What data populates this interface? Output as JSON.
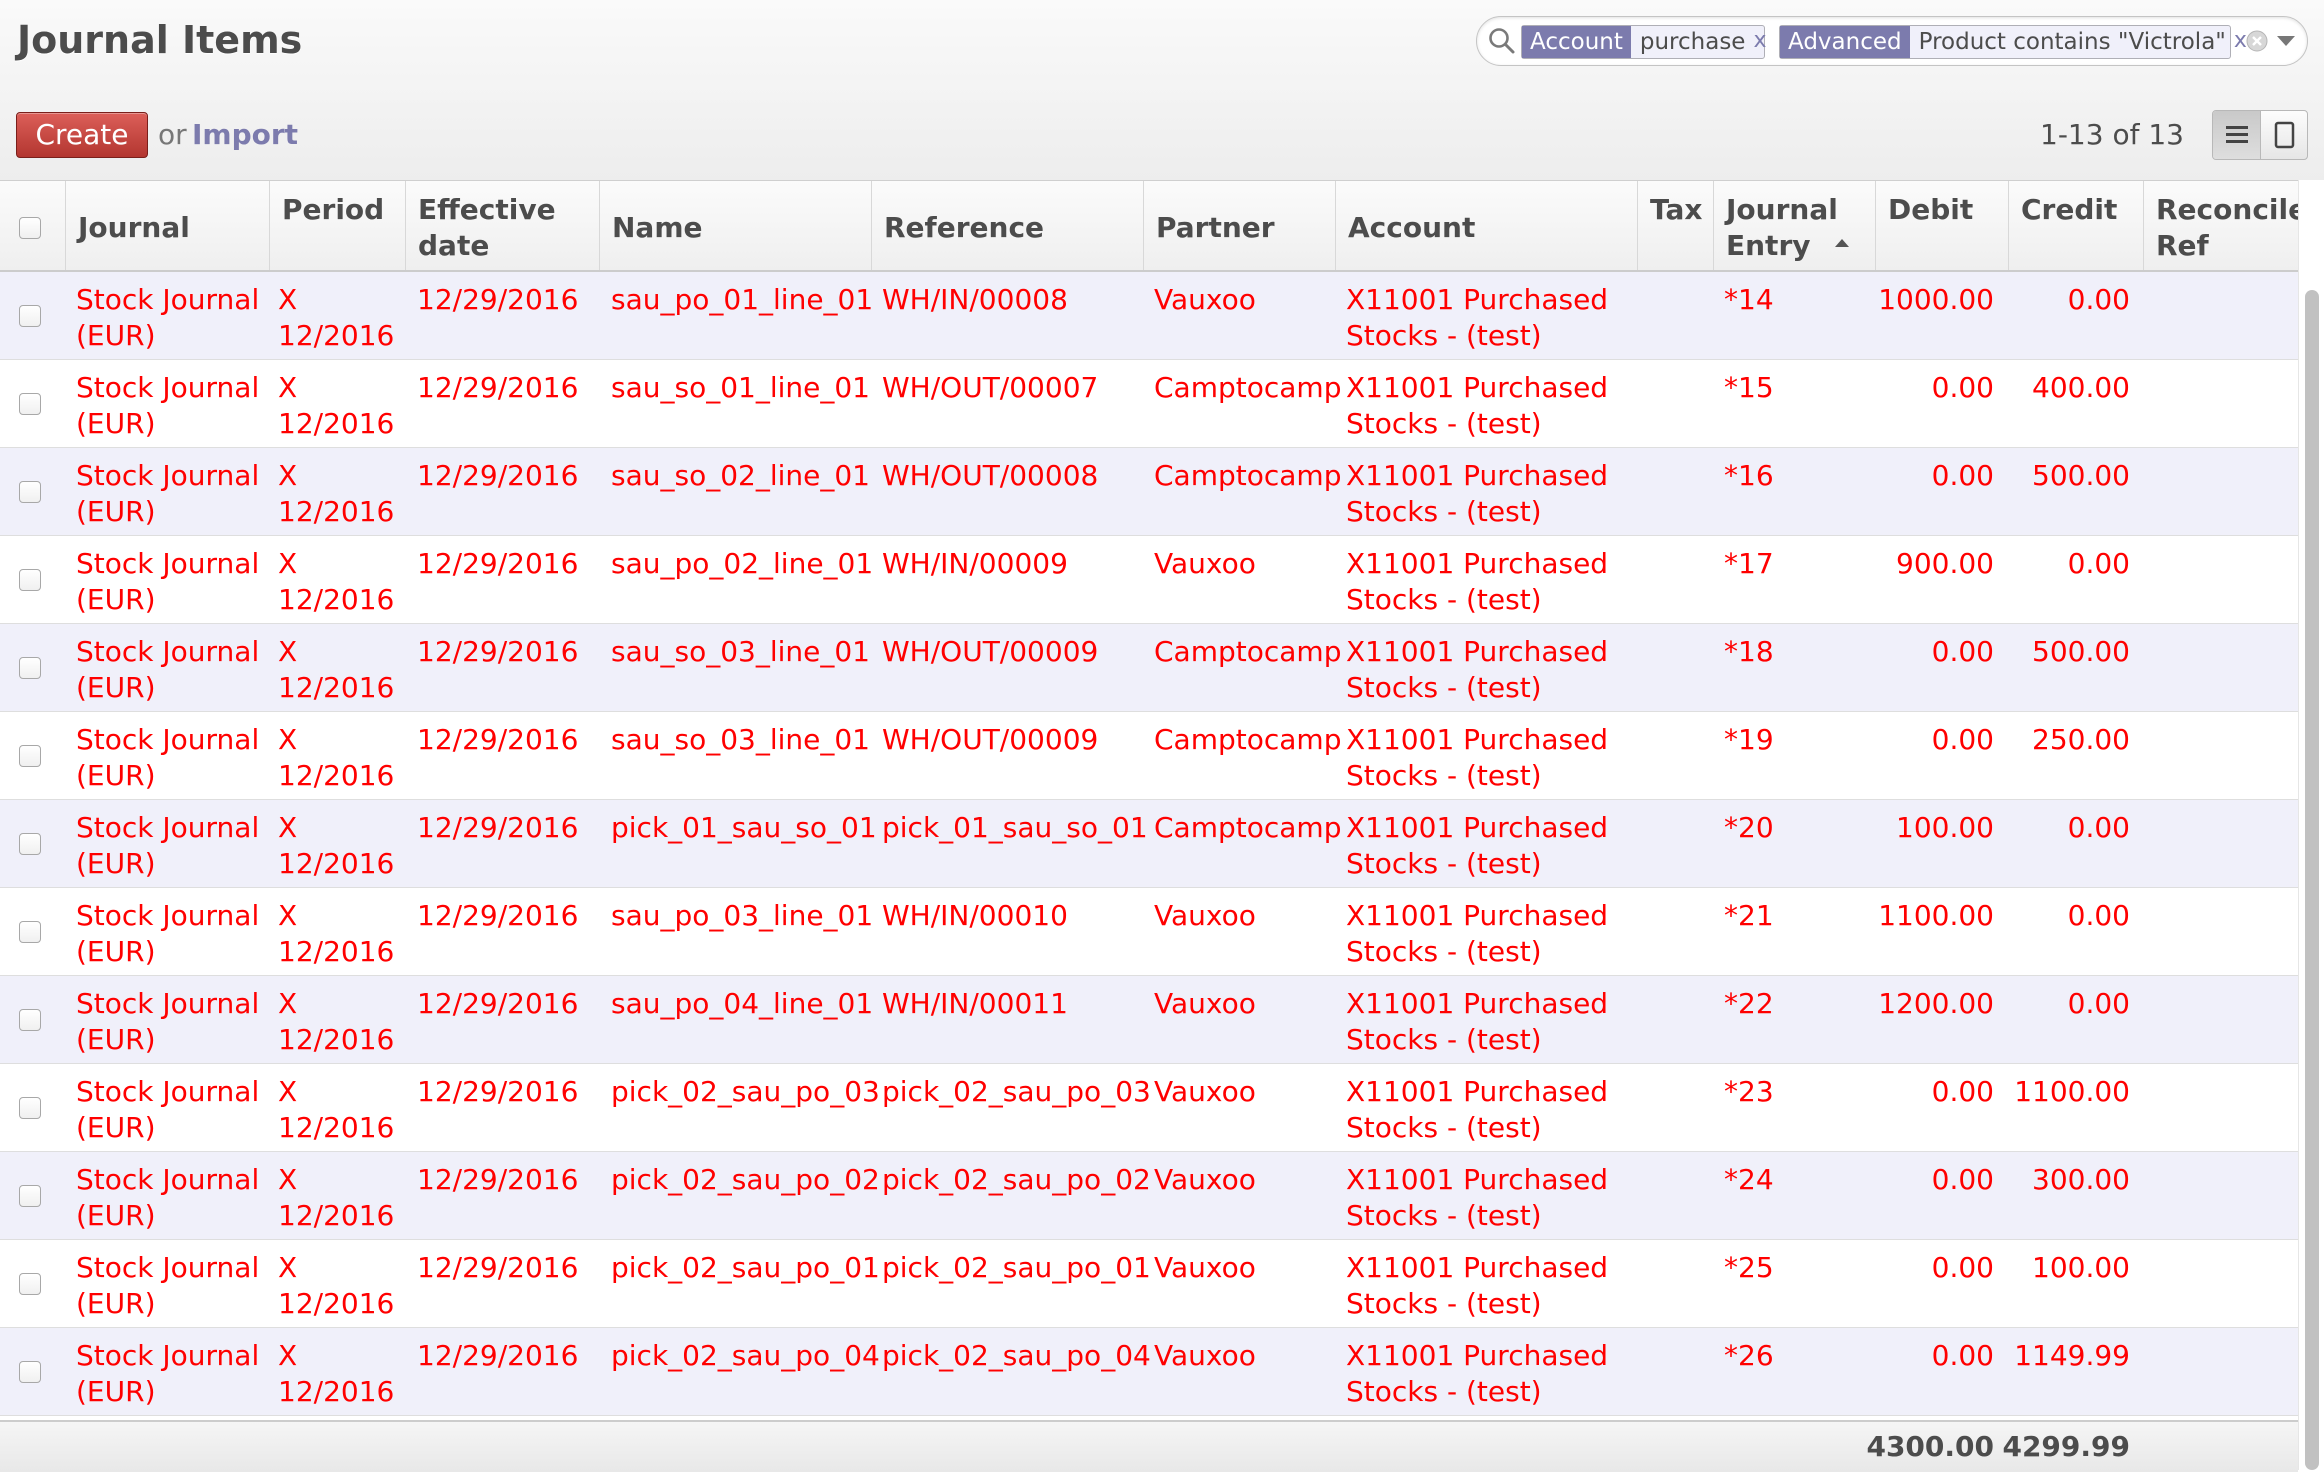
{
  "title": "Journal Items",
  "toolbar": {
    "create_label": "Create",
    "or_label": "or",
    "import_label": "Import"
  },
  "search": {
    "facets": [
      {
        "category": "Account",
        "value": "purchase",
        "remove": "x"
      },
      {
        "category": "Advanced",
        "value": "Product contains \"Victrola\"",
        "remove": "x"
      }
    ]
  },
  "pager": "1-13 of 13",
  "columns": [
    "Journal",
    "Period",
    "Effective date",
    "Name",
    "Reference",
    "Partner",
    "Account",
    "Tax",
    "Journal Entry",
    "Debit",
    "Credit",
    "Reconcile Ref"
  ],
  "rows": [
    {
      "journal": [
        "Stock Journal",
        "(EUR)"
      ],
      "period": [
        "X",
        "12/2016"
      ],
      "date": "12/29/2016",
      "name": "sau_po_01_line_01",
      "reference": "WH/IN/00008",
      "partner": "Vauxoo",
      "account": [
        "X11001 Purchased",
        "Stocks - (test)"
      ],
      "entry": "*14",
      "debit": "1000.00",
      "credit": "0.00"
    },
    {
      "journal": [
        "Stock Journal",
        "(EUR)"
      ],
      "period": [
        "X",
        "12/2016"
      ],
      "date": "12/29/2016",
      "name": "sau_so_01_line_01",
      "reference": "WH/OUT/00007",
      "partner": "Camptocamp",
      "account": [
        "X11001 Purchased",
        "Stocks - (test)"
      ],
      "entry": "*15",
      "debit": "0.00",
      "credit": "400.00"
    },
    {
      "journal": [
        "Stock Journal",
        "(EUR)"
      ],
      "period": [
        "X",
        "12/2016"
      ],
      "date": "12/29/2016",
      "name": "sau_so_02_line_01",
      "reference": "WH/OUT/00008",
      "partner": "Camptocamp",
      "account": [
        "X11001 Purchased",
        "Stocks - (test)"
      ],
      "entry": "*16",
      "debit": "0.00",
      "credit": "500.00"
    },
    {
      "journal": [
        "Stock Journal",
        "(EUR)"
      ],
      "period": [
        "X",
        "12/2016"
      ],
      "date": "12/29/2016",
      "name": "sau_po_02_line_01",
      "reference": "WH/IN/00009",
      "partner": "Vauxoo",
      "account": [
        "X11001 Purchased",
        "Stocks - (test)"
      ],
      "entry": "*17",
      "debit": "900.00",
      "credit": "0.00"
    },
    {
      "journal": [
        "Stock Journal",
        "(EUR)"
      ],
      "period": [
        "X",
        "12/2016"
      ],
      "date": "12/29/2016",
      "name": "sau_so_03_line_01",
      "reference": "WH/OUT/00009",
      "partner": "Camptocamp",
      "account": [
        "X11001 Purchased",
        "Stocks - (test)"
      ],
      "entry": "*18",
      "debit": "0.00",
      "credit": "500.00"
    },
    {
      "journal": [
        "Stock Journal",
        "(EUR)"
      ],
      "period": [
        "X",
        "12/2016"
      ],
      "date": "12/29/2016",
      "name": "sau_so_03_line_01",
      "reference": "WH/OUT/00009",
      "partner": "Camptocamp",
      "account": [
        "X11001 Purchased",
        "Stocks - (test)"
      ],
      "entry": "*19",
      "debit": "0.00",
      "credit": "250.00"
    },
    {
      "journal": [
        "Stock Journal",
        "(EUR)"
      ],
      "period": [
        "X",
        "12/2016"
      ],
      "date": "12/29/2016",
      "name": "pick_01_sau_so_01",
      "reference": "pick_01_sau_so_01",
      "partner": "Camptocamp",
      "account": [
        "X11001 Purchased",
        "Stocks - (test)"
      ],
      "entry": "*20",
      "debit": "100.00",
      "credit": "0.00"
    },
    {
      "journal": [
        "Stock Journal",
        "(EUR)"
      ],
      "period": [
        "X",
        "12/2016"
      ],
      "date": "12/29/2016",
      "name": "sau_po_03_line_01",
      "reference": "WH/IN/00010",
      "partner": "Vauxoo",
      "account": [
        "X11001 Purchased",
        "Stocks - (test)"
      ],
      "entry": "*21",
      "debit": "1100.00",
      "credit": "0.00"
    },
    {
      "journal": [
        "Stock Journal",
        "(EUR)"
      ],
      "period": [
        "X",
        "12/2016"
      ],
      "date": "12/29/2016",
      "name": "sau_po_04_line_01",
      "reference": "WH/IN/00011",
      "partner": "Vauxoo",
      "account": [
        "X11001 Purchased",
        "Stocks - (test)"
      ],
      "entry": "*22",
      "debit": "1200.00",
      "credit": "0.00"
    },
    {
      "journal": [
        "Stock Journal",
        "(EUR)"
      ],
      "period": [
        "X",
        "12/2016"
      ],
      "date": "12/29/2016",
      "name": "pick_02_sau_po_03",
      "reference": "pick_02_sau_po_03",
      "partner": "Vauxoo",
      "account": [
        "X11001 Purchased",
        "Stocks - (test)"
      ],
      "entry": "*23",
      "debit": "0.00",
      "credit": "1100.00"
    },
    {
      "journal": [
        "Stock Journal",
        "(EUR)"
      ],
      "period": [
        "X",
        "12/2016"
      ],
      "date": "12/29/2016",
      "name": "pick_02_sau_po_02",
      "reference": "pick_02_sau_po_02",
      "partner": "Vauxoo",
      "account": [
        "X11001 Purchased",
        "Stocks - (test)"
      ],
      "entry": "*24",
      "debit": "0.00",
      "credit": "300.00"
    },
    {
      "journal": [
        "Stock Journal",
        "(EUR)"
      ],
      "period": [
        "X",
        "12/2016"
      ],
      "date": "12/29/2016",
      "name": "pick_02_sau_po_01",
      "reference": "pick_02_sau_po_01",
      "partner": "Vauxoo",
      "account": [
        "X11001 Purchased",
        "Stocks - (test)"
      ],
      "entry": "*25",
      "debit": "0.00",
      "credit": "100.00"
    },
    {
      "journal": [
        "Stock Journal",
        "(EUR)"
      ],
      "period": [
        "X",
        "12/2016"
      ],
      "date": "12/29/2016",
      "name": "pick_02_sau_po_04",
      "reference": "pick_02_sau_po_04",
      "partner": "Vauxoo",
      "account": [
        "X11001 Purchased",
        "Stocks - (test)"
      ],
      "entry": "*26",
      "debit": "0.00",
      "credit": "1149.99"
    }
  ],
  "totals": {
    "debit": "4300.00",
    "credit": "4299.99"
  },
  "colors": {
    "brand": "#7c7bad",
    "row_text": "#ff0000",
    "create_button": "#c9423c",
    "odd_row": "#f0f0fa"
  },
  "icons": {
    "search": "magnifier-icon",
    "clear": "circle-x-icon",
    "dropdown": "triangle-down-icon",
    "list_view": "list-icon",
    "form_view": "form-icon",
    "sort": "sort-asc-icon"
  }
}
